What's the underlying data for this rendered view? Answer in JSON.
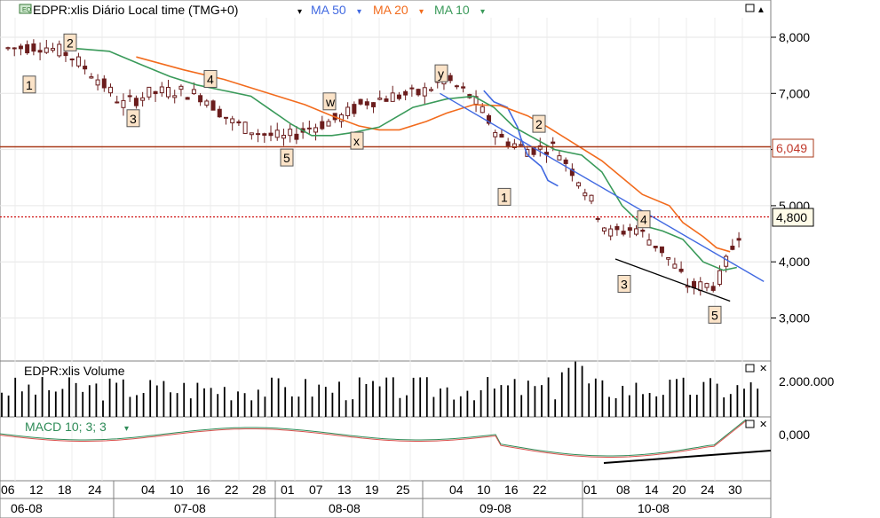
{
  "header": {
    "symbol_label": "EDPR:xlis Diário Local time (TMG+0)",
    "ma50_label": "MA 50",
    "ma20_label": "MA 20",
    "ma10_label": "MA 10",
    "price_tag_1": "6,049",
    "price_tag_2": "4,800"
  },
  "volume_panel": {
    "label": "EDPR:xlis Volume",
    "tick": "2.000.000"
  },
  "macd_panel": {
    "label": "MACD 10; 3; 3",
    "tick": "0,000"
  },
  "colors": {
    "ma50": "#4169e1",
    "ma20": "#f26b1d",
    "ma10": "#3a9a5a",
    "candle_down": "#6b1d1d",
    "hline": "#a83a1a",
    "dotted": "#cc0000",
    "macd_line": "#2e8b57",
    "macd_signal": "#d9534f"
  },
  "icons": [
    "chart-type-icon",
    "restore-icon",
    "scroll-up-icon",
    "close-icon",
    "dropdown-arrow-icon"
  ],
  "chart_data": [
    {
      "type": "candlestick",
      "title": "EDPR:xlis Diário Local time (TMG+0)",
      "ylim": [
        2.3,
        8.6
      ],
      "yticks": [
        "3,000",
        "4,000",
        "5,000",
        "6,000",
        "7,000",
        "8,000"
      ],
      "x_day_labels": [
        "06",
        "12",
        "18",
        "24",
        "04",
        "10",
        "16",
        "22",
        "28",
        "01",
        "07",
        "13",
        "19",
        "25",
        "04",
        "10",
        "16",
        "22",
        "01",
        "08",
        "14",
        "20",
        "24",
        "30"
      ],
      "x_month_labels": [
        "06-08",
        "07-08",
        "08-08",
        "09-08",
        "10-08"
      ],
      "series": [
        {
          "name": "MA 50",
          "values": [
            [
              7.05,
              7.05
            ],
            [
              7.2,
              6.85
            ],
            [
              7.4,
              6.75
            ],
            [
              7.55,
              6.4
            ],
            [
              7.6,
              6.2
            ],
            [
              7.7,
              5.9
            ],
            [
              7.9,
              5.7
            ],
            [
              8.0,
              5.45
            ],
            [
              8.15,
              5.35
            ]
          ]
        },
        {
          "name": "MA 20",
          "values": [
            [
              1.9,
              7.65
            ],
            [
              2.6,
              7.42
            ],
            [
              3.2,
              7.25
            ],
            [
              3.6,
              7.1
            ],
            [
              4.0,
              6.95
            ],
            [
              4.4,
              6.8
            ],
            [
              4.8,
              6.6
            ],
            [
              5.2,
              6.42
            ],
            [
              5.5,
              6.35
            ],
            [
              5.8,
              6.35
            ],
            [
              6.2,
              6.5
            ],
            [
              6.5,
              6.65
            ],
            [
              6.9,
              6.8
            ],
            [
              7.3,
              6.78
            ],
            [
              7.7,
              6.6
            ],
            [
              8.0,
              6.4
            ],
            [
              8.4,
              6.1
            ],
            [
              8.8,
              5.8
            ],
            [
              9.1,
              5.5
            ],
            [
              9.4,
              5.2
            ],
            [
              9.8,
              5.0
            ],
            [
              10.0,
              4.7
            ],
            [
              10.3,
              4.45
            ],
            [
              10.5,
              4.25
            ],
            [
              10.7,
              4.18
            ]
          ]
        },
        {
          "name": "MA 10",
          "values": [
            [
              1.0,
              7.8
            ],
            [
              1.5,
              7.75
            ],
            [
              2.0,
              7.5
            ],
            [
              2.4,
              7.3
            ],
            [
              2.8,
              7.15
            ],
            [
              3.2,
              7.05
            ],
            [
              3.6,
              6.95
            ],
            [
              3.9,
              6.7
            ],
            [
              4.2,
              6.45
            ],
            [
              4.5,
              6.25
            ],
            [
              4.8,
              6.25
            ],
            [
              5.1,
              6.3
            ],
            [
              5.5,
              6.4
            ],
            [
              6.0,
              6.75
            ],
            [
              6.5,
              6.9
            ],
            [
              6.9,
              6.95
            ],
            [
              7.2,
              6.75
            ],
            [
              7.5,
              6.4
            ],
            [
              7.8,
              6.2
            ],
            [
              8.1,
              6.0
            ],
            [
              8.5,
              5.9
            ],
            [
              8.8,
              5.6
            ],
            [
              9.1,
              5.0
            ],
            [
              9.4,
              4.65
            ],
            [
              9.7,
              4.55
            ],
            [
              10.0,
              4.4
            ],
            [
              10.3,
              4.0
            ],
            [
              10.6,
              3.85
            ],
            [
              10.8,
              3.9
            ]
          ]
        }
      ],
      "wave_labels": [
        {
          "label": "1",
          "value": 7.15
        },
        {
          "label": "2",
          "value": 7.9
        },
        {
          "label": "3",
          "value": 6.55
        },
        {
          "label": "4",
          "value": 7.25
        },
        {
          "label": "5",
          "value": 5.85
        },
        {
          "label": "w",
          "value": 6.85
        },
        {
          "label": "x",
          "value": 6.15
        },
        {
          "label": "y",
          "value": 7.35
        },
        {
          "label": "1",
          "value": 5.15
        },
        {
          "label": "2",
          "value": 6.45
        },
        {
          "label": "4",
          "value": 4.75
        },
        {
          "label": "3",
          "value": 3.6
        },
        {
          "label": "5",
          "value": 3.05
        }
      ],
      "horizontal_lines": [
        {
          "value": 6.049,
          "style": "solid"
        },
        {
          "value": 4.8,
          "style": "dotted"
        }
      ]
    },
    {
      "type": "bar",
      "title": "EDPR:xlis Volume",
      "yticks": [
        "2.000.000"
      ]
    },
    {
      "type": "line",
      "title": "MACD 10; 3; 3",
      "yticks": [
        "0,000"
      ]
    }
  ]
}
